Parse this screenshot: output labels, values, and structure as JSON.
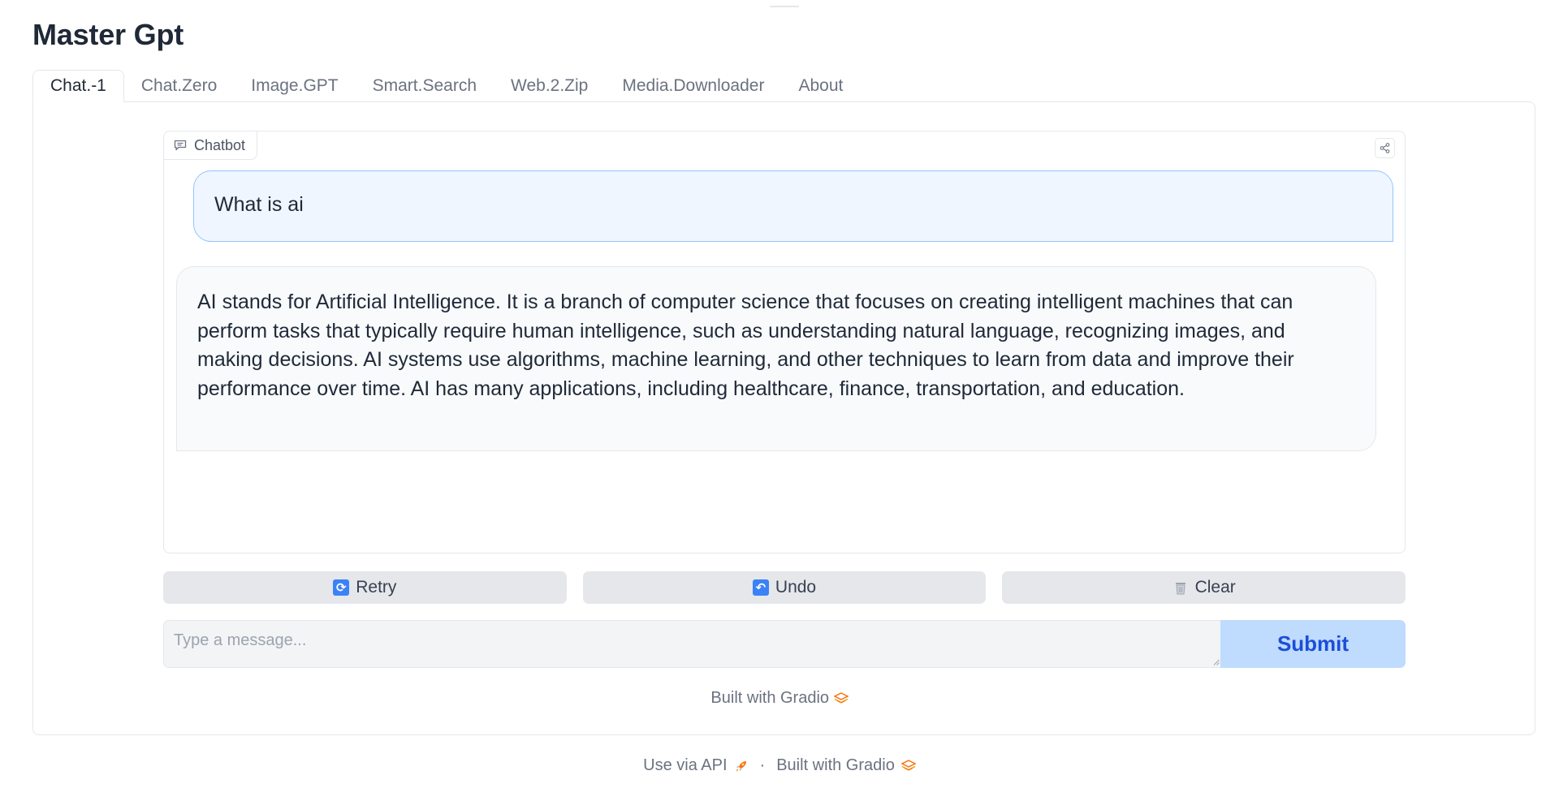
{
  "app": {
    "title": "Master Gpt"
  },
  "tabs": [
    {
      "label": "Chat.-1",
      "active": true
    },
    {
      "label": "Chat.Zero",
      "active": false
    },
    {
      "label": "Image.GPT",
      "active": false
    },
    {
      "label": "Smart.Search",
      "active": false
    },
    {
      "label": "Web.2.Zip",
      "active": false
    },
    {
      "label": "Media.Downloader",
      "active": false
    },
    {
      "label": "About",
      "active": false
    }
  ],
  "chatbot": {
    "label": "Chatbot",
    "icon": "chat-icon",
    "messages": [
      {
        "role": "user",
        "text": "What is ai"
      },
      {
        "role": "bot",
        "text": "AI stands for Artificial Intelligence. It is a branch of computer science that focuses on creating intelligent machines that can perform tasks that typically require human intelligence, such as understanding natural language, recognizing images, and making decisions. AI systems use algorithms, machine learning, and other techniques to learn from data and improve their performance over time. AI has many applications, including healthcare, finance, transportation, and education."
      }
    ]
  },
  "actions": {
    "retry_label": "Retry",
    "undo_label": "Undo",
    "clear_label": "Clear",
    "retry_icon": "retry-arrows-icon",
    "undo_icon": "undo-arrow-icon",
    "clear_icon": "wastebasket-icon"
  },
  "input": {
    "placeholder": "Type a message...",
    "value": "",
    "submit_label": "Submit"
  },
  "footer": {
    "built_inner": "Built with Gradio",
    "api_label": "Use via API",
    "separator": "·",
    "built_label": "Built with Gradio",
    "api_icon": "rocket-icon",
    "gradio_icon": "gradio-logo-icon"
  },
  "colors": {
    "accent": "#1d4ed8",
    "submit_bg": "#bfdbfe",
    "user_bubble": "#eff6ff",
    "user_border": "#93c5fd",
    "bot_bubble": "#f8fafc",
    "button_bg": "#e5e7eb"
  }
}
